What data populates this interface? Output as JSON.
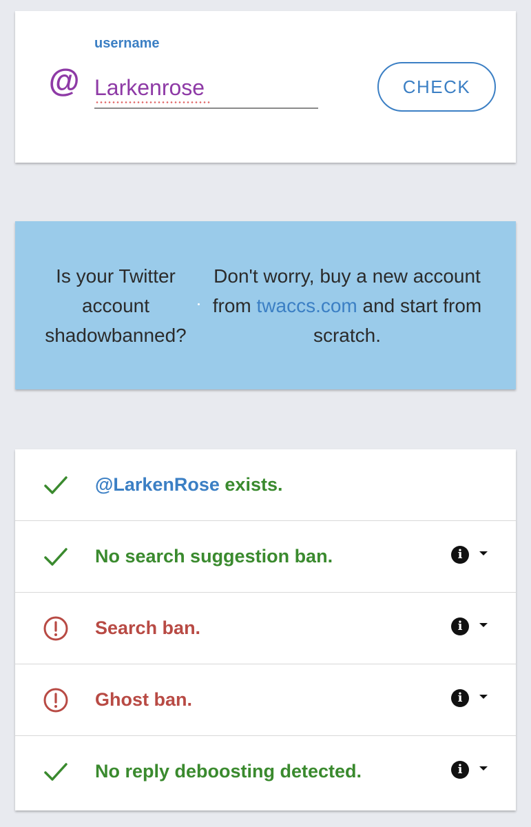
{
  "search": {
    "label": "username",
    "at_symbol": "@",
    "value": "Larkenrose",
    "button_label": "CHECK"
  },
  "ad": {
    "left_text": "Is your Twitter account shadowbanned?",
    "right_before": "Don't worry, buy a new account from ",
    "right_link": "twaccs.com",
    "right_after": " and start from scratch."
  },
  "results": [
    {
      "status": "ok",
      "handle": "@LarkenRose",
      "text": " exists.",
      "icon": "check-icon"
    },
    {
      "status": "ok",
      "text": "No search suggestion ban.",
      "icon": "check-icon",
      "info": true
    },
    {
      "status": "bad",
      "text": "Search ban.",
      "icon": "alert-circle-icon",
      "info": true
    },
    {
      "status": "bad",
      "text": "Ghost ban.",
      "icon": "alert-circle-icon",
      "info": true
    },
    {
      "status": "ok",
      "text": "No reply deboosting detected.",
      "icon": "check-icon",
      "info": true
    }
  ],
  "colors": {
    "background": "#e8eaef",
    "accent_blue": "#3b7fc4",
    "purple": "#8e3aa6",
    "banner_blue": "#9acbea",
    "ok_green": "#3a8a2e",
    "bad_red": "#b84a44"
  }
}
